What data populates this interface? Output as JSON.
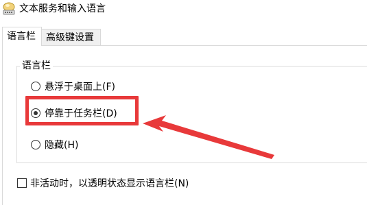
{
  "window": {
    "title": "文本服务和输入语言",
    "icon": "keyboard-language-icon"
  },
  "tabs": [
    {
      "label": "语言栏",
      "active": true
    },
    {
      "label": "高级键设置",
      "active": false
    }
  ],
  "language_bar_group": {
    "legend": "语言栏",
    "options": [
      {
        "label": "悬浮于桌面上(F)",
        "checked": false
      },
      {
        "label": "停靠于任务栏(D)",
        "checked": true
      },
      {
        "label": "隐藏(H)",
        "checked": false
      }
    ]
  },
  "transparency_option": {
    "label": "非活动时，以透明状态显示语言栏(N)",
    "checked": false
  },
  "annotation": {
    "color": "#e8393a"
  }
}
